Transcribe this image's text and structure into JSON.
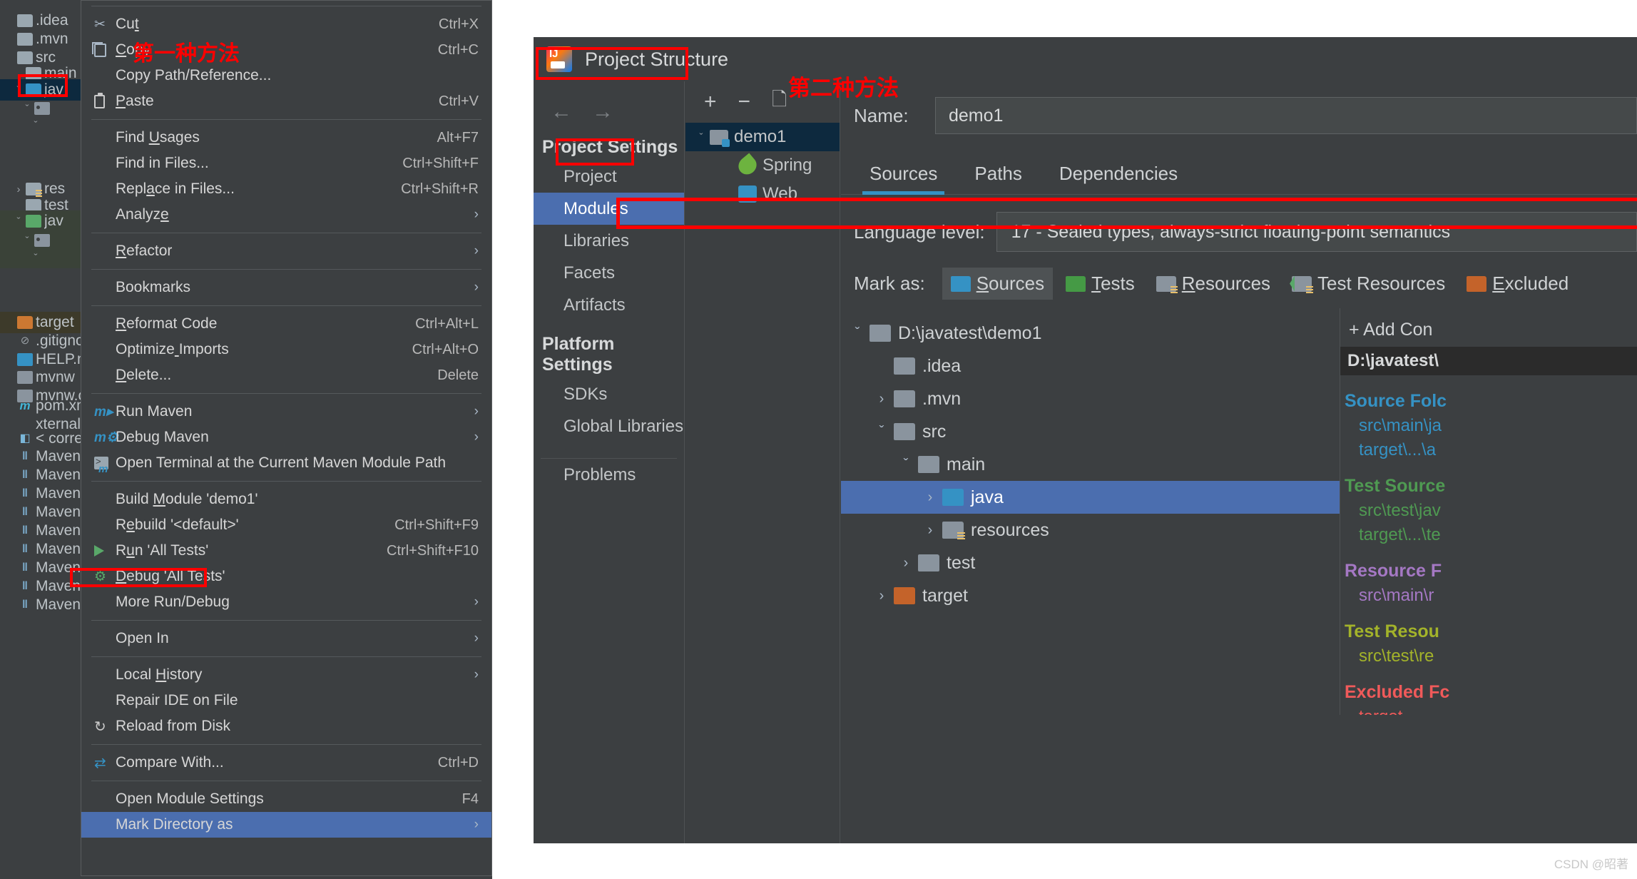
{
  "annotations": {
    "method_one": "第一种方法",
    "method_two": "第二种方法",
    "watermark": "CSDN @昭著"
  },
  "ide": {
    "project_tree": [
      {
        "label": ".idea",
        "icon": "folder-gray",
        "chevron": "",
        "indent": 0,
        "state": "normal"
      },
      {
        "label": ".mvn",
        "icon": "folder-gray",
        "chevron": "",
        "indent": 0,
        "state": "normal"
      },
      {
        "label": "src",
        "icon": "folder-gray",
        "chevron": "",
        "indent": 0,
        "state": "normal"
      },
      {
        "label": "main",
        "icon": "folder-gray",
        "chevron": "",
        "indent": 1,
        "state": "normal"
      },
      {
        "label": "jav",
        "icon": "folder-blue",
        "chevron": "v",
        "indent": 1,
        "state": "selected-dark"
      },
      {
        "label": "",
        "icon": "package-gray",
        "chevron": "v",
        "indent": 2,
        "state": "normal"
      },
      {
        "label": "",
        "icon": "none",
        "chevron": "v",
        "indent": 3,
        "state": "normal"
      },
      {
        "label": "res",
        "icon": "folder-res",
        "chevron": ">",
        "indent": 1,
        "state": "normal"
      },
      {
        "label": "test",
        "icon": "folder-gray",
        "chevron": "",
        "indent": 1,
        "state": "normal"
      },
      {
        "label": "jav",
        "icon": "folder-green",
        "chevron": "v",
        "indent": 1,
        "state": "selected-green"
      },
      {
        "label": "",
        "icon": "package-gray",
        "chevron": "v",
        "indent": 2,
        "state": "selected-green"
      },
      {
        "label": "",
        "icon": "none",
        "chevron": "v",
        "indent": 3,
        "state": "selected-green"
      },
      {
        "label": "target",
        "icon": "folder-orange",
        "chevron": "",
        "indent": 0,
        "state": "selected-olive"
      },
      {
        "label": ".gitignore",
        "icon": "gitignore",
        "chevron": "",
        "indent": 0,
        "state": "normal"
      },
      {
        "label": "HELP.md",
        "icon": "help-md",
        "chevron": "",
        "indent": 0,
        "state": "normal"
      },
      {
        "label": "mvnw",
        "icon": "file-gray",
        "chevron": "",
        "indent": 0,
        "state": "normal"
      },
      {
        "label": "mvnw.cm",
        "icon": "file-gray",
        "chevron": "",
        "indent": 0,
        "state": "normal"
      },
      {
        "label": "pom.xml",
        "icon": "xml-file",
        "chevron": "",
        "indent": 0,
        "state": "normal"
      },
      {
        "label": "xternal Libr",
        "icon": "none",
        "chevron": "",
        "indent": 0,
        "state": "normal"
      },
      {
        "label": "< corrett",
        "icon": "sdk",
        "chevron": "",
        "indent": 0,
        "state": "normal"
      },
      {
        "label": "Maven: c",
        "icon": "maven-lib",
        "chevron": "",
        "indent": 0,
        "state": "normal"
      },
      {
        "label": "Maven: c",
        "icon": "maven-lib",
        "chevron": "",
        "indent": 0,
        "state": "normal"
      },
      {
        "label": "Maven: c",
        "icon": "maven-lib",
        "chevron": "",
        "indent": 0,
        "state": "normal"
      },
      {
        "label": "Maven: c",
        "icon": "maven-lib",
        "chevron": "",
        "indent": 0,
        "state": "normal"
      },
      {
        "label": "Maven: c",
        "icon": "maven-lib",
        "chevron": "",
        "indent": 0,
        "state": "normal"
      },
      {
        "label": "Maven: c",
        "icon": "maven-lib",
        "chevron": "",
        "indent": 0,
        "state": "normal"
      },
      {
        "label": "Maven: c",
        "icon": "maven-lib",
        "chevron": "",
        "indent": 0,
        "state": "normal"
      },
      {
        "label": "Maven: c",
        "icon": "maven-lib",
        "chevron": "",
        "indent": 0,
        "state": "normal"
      },
      {
        "label": "Maven: c",
        "icon": "maven-lib",
        "chevron": "",
        "indent": 0,
        "state": "normal"
      }
    ]
  },
  "context_menu": {
    "items": [
      {
        "type": "separator"
      },
      {
        "type": "item",
        "label": "Cut",
        "icon": "cut-icon",
        "shortcut": "Ctrl+X",
        "arrow": false,
        "mnemonic_index": 2
      },
      {
        "type": "item",
        "label": "Copy",
        "icon": "copy-icon",
        "shortcut": "Ctrl+C",
        "arrow": false,
        "mnemonic_index": 0
      },
      {
        "type": "item",
        "label": "Copy Path/Reference...",
        "icon": "none",
        "shortcut": "",
        "arrow": false,
        "mnemonic_index": -1
      },
      {
        "type": "item",
        "label": "Paste",
        "icon": "paste-icon",
        "shortcut": "Ctrl+V",
        "arrow": false,
        "mnemonic_index": 0
      },
      {
        "type": "separator"
      },
      {
        "type": "item",
        "label": "Find Usages",
        "icon": "none",
        "shortcut": "Alt+F7",
        "arrow": false,
        "mnemonic_index": 5
      },
      {
        "type": "item",
        "label": "Find in Files...",
        "icon": "none",
        "shortcut": "Ctrl+Shift+F",
        "arrow": false,
        "mnemonic_index": -1
      },
      {
        "type": "item",
        "label": "Replace in Files...",
        "icon": "none",
        "shortcut": "Ctrl+Shift+R",
        "arrow": false,
        "mnemonic_index": 4
      },
      {
        "type": "item",
        "label": "Analyze",
        "icon": "none",
        "shortcut": "",
        "arrow": true,
        "mnemonic_index": 6
      },
      {
        "type": "separator"
      },
      {
        "type": "item",
        "label": "Refactor",
        "icon": "none",
        "shortcut": "",
        "arrow": true,
        "mnemonic_index": 0
      },
      {
        "type": "separator"
      },
      {
        "type": "item",
        "label": "Bookmarks",
        "icon": "none",
        "shortcut": "",
        "arrow": true,
        "mnemonic_index": -1
      },
      {
        "type": "separator"
      },
      {
        "type": "item",
        "label": "Reformat Code",
        "icon": "none",
        "shortcut": "Ctrl+Alt+L",
        "arrow": false,
        "mnemonic_index": 0
      },
      {
        "type": "item",
        "label": "Optimize Imports",
        "icon": "none",
        "shortcut": "Ctrl+Alt+O",
        "arrow": false,
        "mnemonic_index": 8
      },
      {
        "type": "item",
        "label": "Delete...",
        "icon": "none",
        "shortcut": "Delete",
        "arrow": false,
        "mnemonic_index": 0
      },
      {
        "type": "separator"
      },
      {
        "type": "item",
        "label": "Run Maven",
        "icon": "maven-run-icon",
        "shortcut": "",
        "arrow": true,
        "mnemonic_index": -1
      },
      {
        "type": "item",
        "label": "Debug Maven",
        "icon": "maven-debug-icon",
        "shortcut": "",
        "arrow": true,
        "mnemonic_index": -1
      },
      {
        "type": "item",
        "label": "Open Terminal at the Current Maven Module Path",
        "icon": "terminal-icon",
        "shortcut": "",
        "arrow": false,
        "mnemonic_index": -1
      },
      {
        "type": "separator"
      },
      {
        "type": "item",
        "label": "Build Module 'demo1'",
        "icon": "none",
        "shortcut": "",
        "arrow": false,
        "mnemonic_index": 6
      },
      {
        "type": "item",
        "label": "Rebuild '<default>'",
        "icon": "none",
        "shortcut": "Ctrl+Shift+F9",
        "arrow": false,
        "mnemonic_index": 1
      },
      {
        "type": "item",
        "label": "Run 'All Tests'",
        "icon": "run-icon",
        "shortcut": "Ctrl+Shift+F10",
        "arrow": false,
        "mnemonic_index": 1
      },
      {
        "type": "item",
        "label": "Debug 'All Tests'",
        "icon": "debug-icon",
        "shortcut": "",
        "arrow": false,
        "mnemonic_index": 0
      },
      {
        "type": "item",
        "label": "More Run/Debug",
        "icon": "none",
        "shortcut": "",
        "arrow": true,
        "mnemonic_index": -1
      },
      {
        "type": "separator"
      },
      {
        "type": "item",
        "label": "Open In",
        "icon": "none",
        "shortcut": "",
        "arrow": true,
        "mnemonic_index": -1
      },
      {
        "type": "separator"
      },
      {
        "type": "item",
        "label": "Local History",
        "icon": "none",
        "shortcut": "",
        "arrow": true,
        "mnemonic_index": 6
      },
      {
        "type": "item",
        "label": "Repair IDE on File",
        "icon": "none",
        "shortcut": "",
        "arrow": false,
        "mnemonic_index": -1
      },
      {
        "type": "item",
        "label": "Reload from Disk",
        "icon": "reload-icon",
        "shortcut": "",
        "arrow": false,
        "mnemonic_index": -1
      },
      {
        "type": "separator"
      },
      {
        "type": "item",
        "label": "Compare With...",
        "icon": "compare-icon",
        "shortcut": "Ctrl+D",
        "arrow": false,
        "mnemonic_index": -1
      },
      {
        "type": "separator"
      },
      {
        "type": "item",
        "label": "Open Module Settings",
        "icon": "none",
        "shortcut": "F4",
        "arrow": false,
        "mnemonic_index": -1
      },
      {
        "type": "item",
        "label": "Mark Directory as",
        "icon": "none",
        "shortcut": "",
        "arrow": true,
        "mnemonic_index": -1,
        "highlight": true
      }
    ]
  },
  "project_structure": {
    "title": "Project Structure",
    "nav_back": "←",
    "nav_forward": "→",
    "groups": [
      {
        "title": "Project Settings",
        "items": [
          "Project",
          "Modules",
          "Libraries",
          "Facets",
          "Artifacts"
        ]
      },
      {
        "title": "Platform Settings",
        "items": [
          "SDKs",
          "Global Libraries"
        ]
      }
    ],
    "active_nav_item": "Modules",
    "problems_label": "Problems",
    "module_toolbar": {
      "add": "+",
      "remove": "−",
      "copy": "copy-icon"
    },
    "module_tree": [
      {
        "label": "demo1",
        "icon": "module-icon",
        "chevron": "v",
        "indent": 0,
        "selected": true
      },
      {
        "label": "Spring",
        "icon": "spring-icon",
        "chevron": "",
        "indent": 1,
        "selected": false
      },
      {
        "label": "Web",
        "icon": "web-icon",
        "chevron": "",
        "indent": 1,
        "selected": false
      }
    ],
    "name_label": "Name:",
    "name_value": "demo1",
    "tabs": [
      "Sources",
      "Paths",
      "Dependencies"
    ],
    "active_tab": "Sources",
    "language_level_label": "Language level:",
    "language_level_value": "17 - Sealed types, always-strict floating-point semantics",
    "mark_as_label": "Mark as:",
    "mark_as_buttons": [
      {
        "label": "Sources",
        "color": "blue",
        "selected": true,
        "mnemonic_index": 0
      },
      {
        "label": "Tests",
        "color": "green",
        "selected": false,
        "mnemonic_index": 0
      },
      {
        "label": "Resources",
        "color": "gray",
        "selected": false,
        "mnemonic_index": 0
      },
      {
        "label": "Test Resources",
        "color": "tres",
        "selected": false,
        "mnemonic_index": -1
      },
      {
        "label": "Excluded",
        "color": "orange",
        "selected": false,
        "mnemonic_index": 0
      }
    ],
    "file_tree": [
      {
        "label": "D:\\javatest\\demo1",
        "icon": "folder-gray",
        "chevron": "v",
        "indent": 0,
        "selected": false
      },
      {
        "label": ".idea",
        "icon": "folder-gray",
        "chevron": "",
        "indent": 1,
        "selected": false
      },
      {
        "label": ".mvn",
        "icon": "folder-gray",
        "chevron": ">",
        "indent": 1,
        "selected": false
      },
      {
        "label": "src",
        "icon": "folder-gray",
        "chevron": "v",
        "indent": 1,
        "selected": false
      },
      {
        "label": "main",
        "icon": "folder-gray",
        "chevron": "v",
        "indent": 2,
        "selected": false
      },
      {
        "label": "java",
        "icon": "folder-blue",
        "chevron": ">",
        "indent": 3,
        "selected": true
      },
      {
        "label": "resources",
        "icon": "folder-res",
        "chevron": ">",
        "indent": 3,
        "selected": false
      },
      {
        "label": "test",
        "icon": "folder-gray",
        "chevron": ">",
        "indent": 2,
        "selected": false
      },
      {
        "label": "target",
        "icon": "folder-orange",
        "chevron": ">",
        "indent": 1,
        "selected": false
      }
    ],
    "add_content_label": "+ Add Con",
    "content_root_path": "D:\\javatest\\",
    "folder_groups": [
      {
        "title": "Source Folc",
        "color": "#3592c4",
        "items": [
          "src\\main\\ja",
          "target\\...\\a"
        ]
      },
      {
        "title": "Test Source",
        "color": "#4f9a52",
        "items": [
          "src\\test\\jav",
          "target\\...\\te"
        ]
      },
      {
        "title": "Resource F",
        "color": "#a578c4",
        "items": [
          "src\\main\\r"
        ]
      },
      {
        "title": "Test Resou",
        "color": "#a3b32a",
        "items": [
          "src\\test\\re"
        ]
      },
      {
        "title": "Excluded Fc",
        "color": "#f05a5a",
        "items": [
          "target"
        ]
      }
    ]
  }
}
